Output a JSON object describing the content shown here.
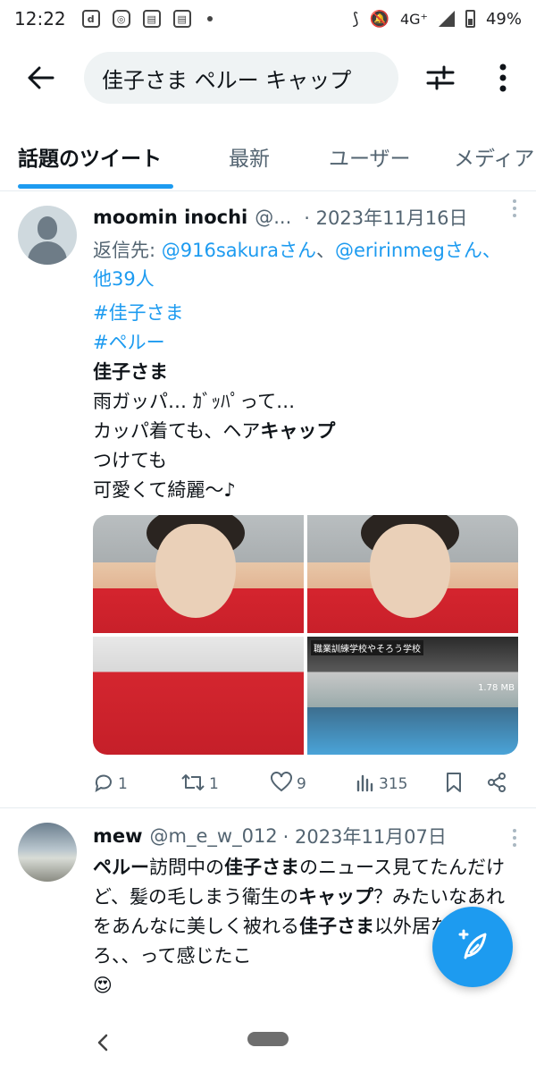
{
  "status_bar": {
    "time": "12:22",
    "icons": [
      "docomo-icon",
      "instagram-icon",
      "news-icon",
      "news-icon",
      "dot-icon"
    ],
    "network": "4G⁺",
    "battery": "49%"
  },
  "search": {
    "query": "佳子さま ペルー キャップ"
  },
  "tabs": [
    {
      "label": "話題のツイート",
      "active": true
    },
    {
      "label": "最新",
      "active": false
    },
    {
      "label": "ユーザー",
      "active": false
    },
    {
      "label": "メディア",
      "active": false
    }
  ],
  "tweets": [
    {
      "name": "moomin inochi",
      "handle": "@...",
      "date": "· 2023年11月16日",
      "reply_prefix": "返信先: ",
      "reply_user1": "@916sakuraさん",
      "reply_sep": "、",
      "reply_user2": "@eririnmegさん",
      "reply_suffix": "、他39人",
      "hashtag1": "#佳子さま",
      "hashtag2": "#ペルー",
      "line_bold": "佳子さま",
      "body": "雨ガッパ… ｶﾞｯﾊﾟって…\nカッパ着ても、ヘア",
      "body_bold": "キャップ",
      "body_tail": "\nつけても\n可愛くて綺麗～♪",
      "media_labels": {
        "tv_title": "職業訓練学校やそろう学校",
        "tv_sub": "1.78 MB"
      },
      "stats": {
        "replies": "1",
        "retweets": "1",
        "likes": "9",
        "views": "315"
      }
    },
    {
      "name": "mew",
      "handle": "@m_e_w_012",
      "date": "· 2023年11月07日",
      "seg1_bold": "ペルー",
      "seg2": "訪問中の",
      "seg3_bold": "佳子さま",
      "seg4": "のニュース見てたんだけど、髪の毛しまう衛生の",
      "seg5_bold": "キャップ",
      "seg6": "？みたいなあれをあんなに美しく被れる",
      "seg7_bold": "佳子さま",
      "seg8": "以外居ないだろ、、って感じたこ",
      "emoji": "😍"
    }
  ],
  "colors": {
    "accent": "#1d9bf0",
    "text": "#0f1419",
    "muted": "#536471"
  }
}
